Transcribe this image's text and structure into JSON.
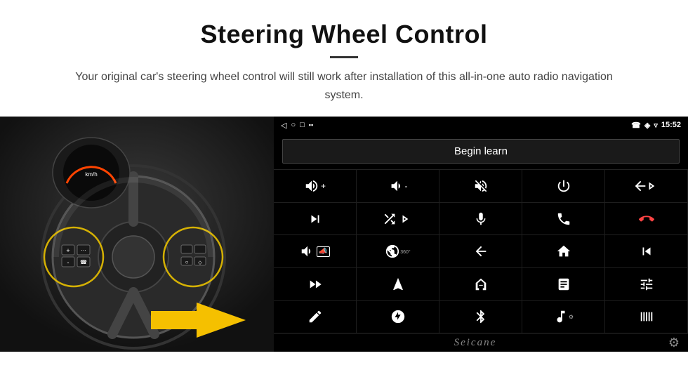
{
  "header": {
    "title": "Steering Wheel Control",
    "subtitle": "Your original car's steering wheel control will still work after installation of this all-in-one auto radio navigation system."
  },
  "status_bar": {
    "time": "15:52",
    "back_icon": "◁",
    "home_icon": "○",
    "recent_icon": "□",
    "signal_icon": "▪▪",
    "phone_icon": "☎",
    "location_icon": "◈",
    "wifi_icon": "▿"
  },
  "begin_learn": {
    "label": "Begin learn"
  },
  "controls": [
    {
      "icon": "vol_up",
      "symbol": "🔊+"
    },
    {
      "icon": "vol_down",
      "symbol": "🔉-"
    },
    {
      "icon": "mute",
      "symbol": "🔇"
    },
    {
      "icon": "power",
      "symbol": "⏻"
    },
    {
      "icon": "prev_track",
      "symbol": "⏮"
    },
    {
      "icon": "next_track",
      "symbol": "⏭"
    },
    {
      "icon": "shuffle",
      "symbol": "⤮"
    },
    {
      "icon": "fast_forward",
      "symbol": "⏩"
    },
    {
      "icon": "mic",
      "symbol": "🎤"
    },
    {
      "icon": "phone",
      "symbol": "📞"
    },
    {
      "icon": "hang_up",
      "symbol": "↩"
    },
    {
      "icon": "horn",
      "symbol": "📣"
    },
    {
      "icon": "camera_360",
      "symbol": "🎥"
    },
    {
      "icon": "back",
      "symbol": "↩"
    },
    {
      "icon": "home",
      "symbol": "⌂"
    },
    {
      "icon": "skip_back",
      "symbol": "⏮"
    },
    {
      "icon": "skip_fwd",
      "symbol": "⏭"
    },
    {
      "icon": "navigation",
      "symbol": "➤"
    },
    {
      "icon": "eq",
      "symbol": "⇌"
    },
    {
      "icon": "recorder",
      "symbol": "📼"
    },
    {
      "icon": "eq2",
      "symbol": "🎛"
    },
    {
      "icon": "pen",
      "symbol": "✏"
    },
    {
      "icon": "target",
      "symbol": "◎"
    },
    {
      "icon": "bluetooth",
      "symbol": "✱"
    },
    {
      "icon": "music",
      "symbol": "♫"
    },
    {
      "icon": "levels",
      "symbol": "▐▌▐"
    }
  ],
  "bottom": {
    "brand": "Seicane",
    "gear_icon": "⚙"
  }
}
